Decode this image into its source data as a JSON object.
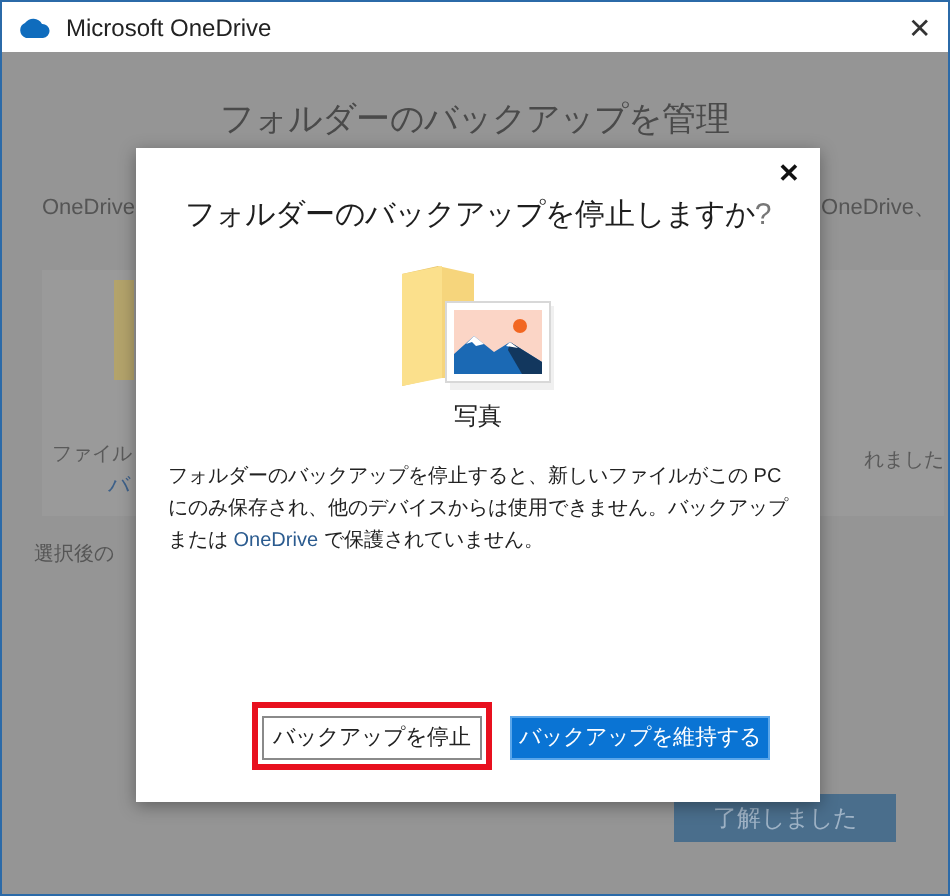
{
  "window": {
    "title": "Microsoft OneDrive",
    "close": "✕"
  },
  "background": {
    "heading": "フォルダーのバックアップを管理",
    "intro_left": "OneDrive",
    "intro_right": "OneDrive、",
    "left_card": {
      "line_1": "ファイル",
      "link": "バ"
    },
    "right_card": {
      "line_1": "れました"
    },
    "note": "選択後の",
    "button": "了解しました"
  },
  "dialog": {
    "close": "✕",
    "title": "フォルダーのバックアップを停止しますか",
    "title_mark": "?",
    "folder_label": "写真",
    "message": [
      {
        "kind": "plain",
        "text": "フォルダーのバックアップを停止すると、新しいファイルがこの "
      },
      {
        "kind": "plain",
        "text": "PC"
      },
      {
        "kind": "plain",
        "text": " にのみ保存され、他のデバイスからは使用できません。バックアップまたは "
      },
      {
        "kind": "brand",
        "text": "OneDrive"
      },
      {
        "kind": "plain",
        "text": " で保護されていません。"
      }
    ],
    "buttons": [
      {
        "label": "バックアップを停止",
        "kind": "secondary",
        "highlighted": true
      },
      {
        "label": "バックアップを維持する",
        "kind": "primary",
        "highlighted": false
      }
    ]
  }
}
